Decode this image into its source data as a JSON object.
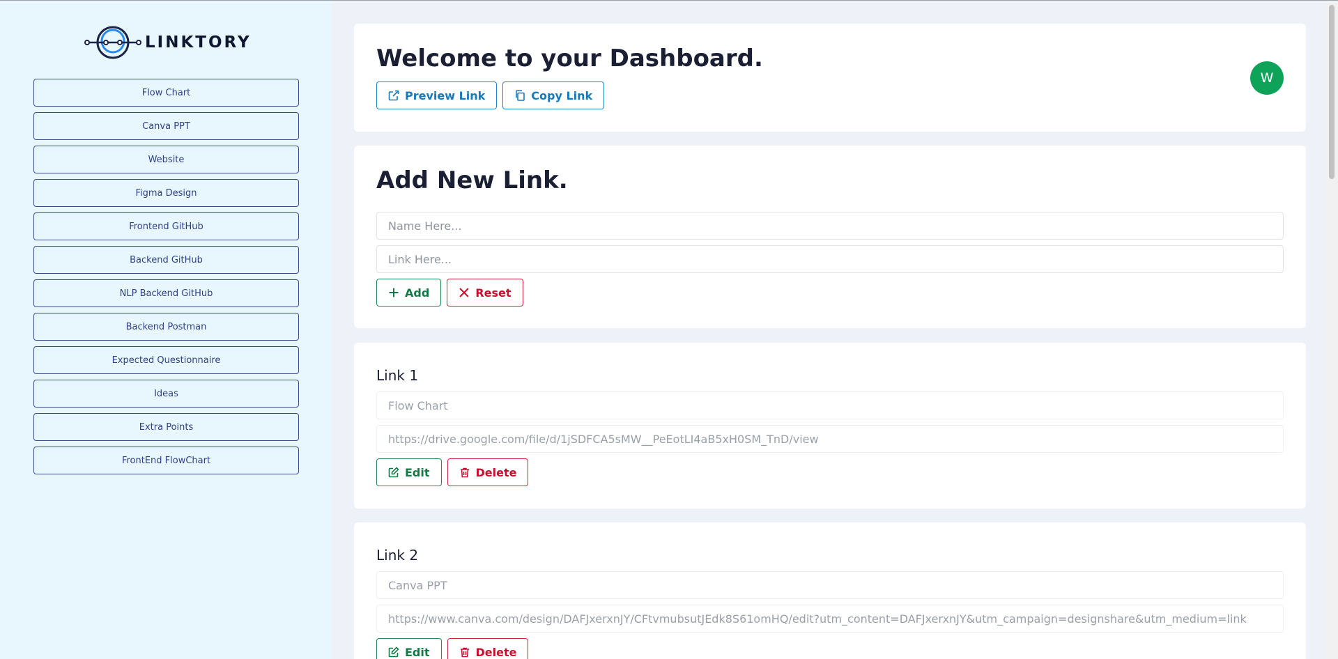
{
  "brand": {
    "name": "LINKTORY",
    "logo_icon": "circle-link-logo-icon",
    "color_primary": "#2e3f85",
    "color_accent": "#2a8af0"
  },
  "sidebar": {
    "items": [
      {
        "label": "Flow Chart"
      },
      {
        "label": "Canva PPT"
      },
      {
        "label": "Website"
      },
      {
        "label": "Figma Design"
      },
      {
        "label": "Frontend GitHub"
      },
      {
        "label": "Backend GitHub"
      },
      {
        "label": "NLP Backend GitHub"
      },
      {
        "label": "Backend Postman"
      },
      {
        "label": "Expected Questionnaire"
      },
      {
        "label": "Ideas"
      },
      {
        "label": "Extra Points"
      },
      {
        "label": "FrontEnd FlowChart"
      }
    ]
  },
  "welcome": {
    "title": "Welcome to your Dashboard.",
    "preview_label": "Preview Link",
    "copy_label": "Copy Link",
    "avatar_initial": "W",
    "avatar_color": "#0fa35a"
  },
  "add_link": {
    "title": "Add New Link.",
    "name_placeholder": "Name Here...",
    "link_placeholder": "Link Here...",
    "add_label": "Add",
    "reset_label": "Reset"
  },
  "links": [
    {
      "title": "Link 1",
      "name": "Flow Chart",
      "url": "https://drive.google.com/file/d/1jSDFCA5sMW__PeEotLI4aB5xH0SM_TnD/view",
      "edit_label": "Edit",
      "delete_label": "Delete"
    },
    {
      "title": "Link 2",
      "name": "Canva PPT",
      "url": "https://www.canva.com/design/DAFJxerxnJY/CFtvmubsutJEdk8S61omHQ/edit?utm_content=DAFJxerxnJY&utm_campaign=designshare&utm_medium=link",
      "edit_label": "Edit",
      "delete_label": "Delete"
    }
  ],
  "colors": {
    "green": "#137a45",
    "red": "#c8102e",
    "blue": "#1479bd",
    "sidebar_bg": "#e8f7fe",
    "page_bg": "#eef1f8"
  }
}
